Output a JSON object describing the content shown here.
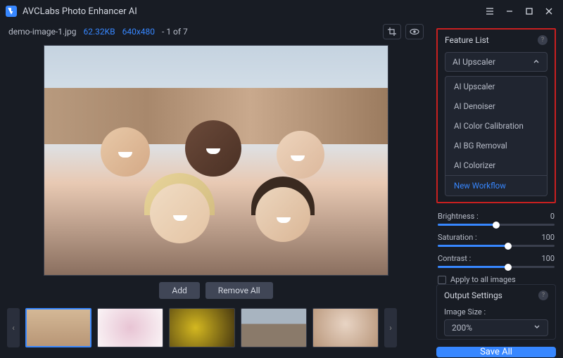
{
  "app": {
    "title": "AVCLabs Photo Enhancer AI"
  },
  "file": {
    "name": "demo-image-1.jpg",
    "size": "62.32KB",
    "dim": "640x480",
    "index": "- 1 of 7"
  },
  "actions": {
    "add": "Add",
    "removeAll": "Remove All"
  },
  "feature": {
    "title": "Feature List",
    "selected": "AI Upscaler",
    "items": [
      "AI Upscaler",
      "AI Denoiser",
      "AI Color Calibration",
      "AI BG Removal",
      "AI Colorizer"
    ],
    "newWorkflow": "New Workflow"
  },
  "adjust": {
    "brightness": {
      "label": "Brightness :",
      "value": "0",
      "pct": 50
    },
    "saturation": {
      "label": "Saturation :",
      "value": "100",
      "pct": 60
    },
    "contrast": {
      "label": "Contrast :",
      "value": "100",
      "pct": 60
    },
    "applyAll": "Apply to all images"
  },
  "output": {
    "title": "Output Settings",
    "sizeLabel": "Image Size :",
    "sizeValue": "200%"
  },
  "save": "Save All"
}
